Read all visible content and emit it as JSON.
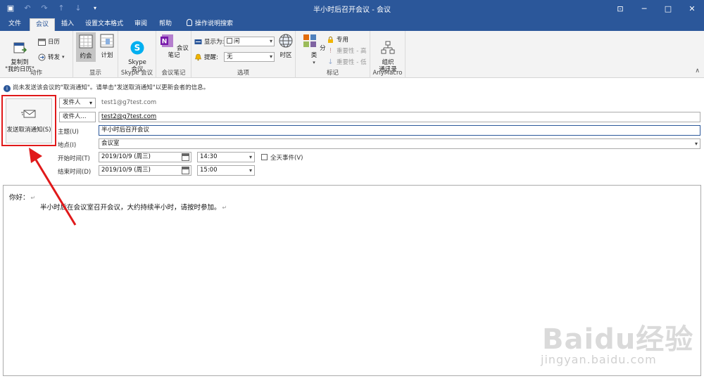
{
  "window": {
    "title": "半小时后召开会议  -  会议"
  },
  "tabs": [
    {
      "label": "文件"
    },
    {
      "label": "会议"
    },
    {
      "label": "插入"
    },
    {
      "label": "设置文本格式"
    },
    {
      "label": "审阅"
    },
    {
      "label": "帮助"
    },
    {
      "label": "操作说明搜索"
    }
  ],
  "ribbon": {
    "actions": {
      "copy_to_calendar": "复制到\n\"我的日历\"",
      "calendar": "日历",
      "forward": "转发",
      "group_label": "动作"
    },
    "display": {
      "appointment": "约会",
      "plan": "计划",
      "group_label": "显示"
    },
    "skype": {
      "button": "Skype\n会议",
      "group_label": "Skype 会议"
    },
    "notes": {
      "button": "会议笔记",
      "group_label": "会议笔记"
    },
    "options": {
      "show_as_label": "显示为:",
      "show_as_value": "闲",
      "reminder_label": "提醒:",
      "reminder_value": "无",
      "timezone": "时区",
      "group_label": "选项"
    },
    "tags": {
      "categorize": "分类",
      "private": "专用",
      "high_importance": "重要性 - 高",
      "low_importance": "重要性 - 低",
      "group_label": "标记"
    },
    "anymacro": {
      "button": "组织\n通讯录",
      "group_label": "AnyMacro"
    }
  },
  "infobar": {
    "text": "尚未发送该会议的\"取消通知\"。请单击\"发送取消通知\"以更新会者的信息。"
  },
  "send_cancel": {
    "label": "发送取消通知(S)"
  },
  "form": {
    "from_button": "发件人",
    "from_value": "test1@g7test.com",
    "to_button": "收件人...",
    "to_value": "test2@g7test.com",
    "subject_label": "主题(U)",
    "subject_value": "半小时后召开会议",
    "location_label": "地点(I)",
    "location_value": "会议室",
    "start_label": "开始时间(T)",
    "start_date": "2019/10/9 (周三)",
    "start_time": "14:30",
    "end_label": "结束时间(D)",
    "end_date": "2019/10/9 (周三)",
    "end_time": "15:00",
    "all_day_label": "全天事件(V)"
  },
  "body": {
    "line1": "你好：",
    "line2": "半小时后在会议室召开会议，大约持续半小时，请按时参加。",
    "para_mark": "↵"
  },
  "watermark": {
    "logo": "Baidu经验",
    "url": "jingyan.baidu.com"
  },
  "colors": {
    "accent": "#2b579a",
    "highlight_box": "#e0191a"
  }
}
